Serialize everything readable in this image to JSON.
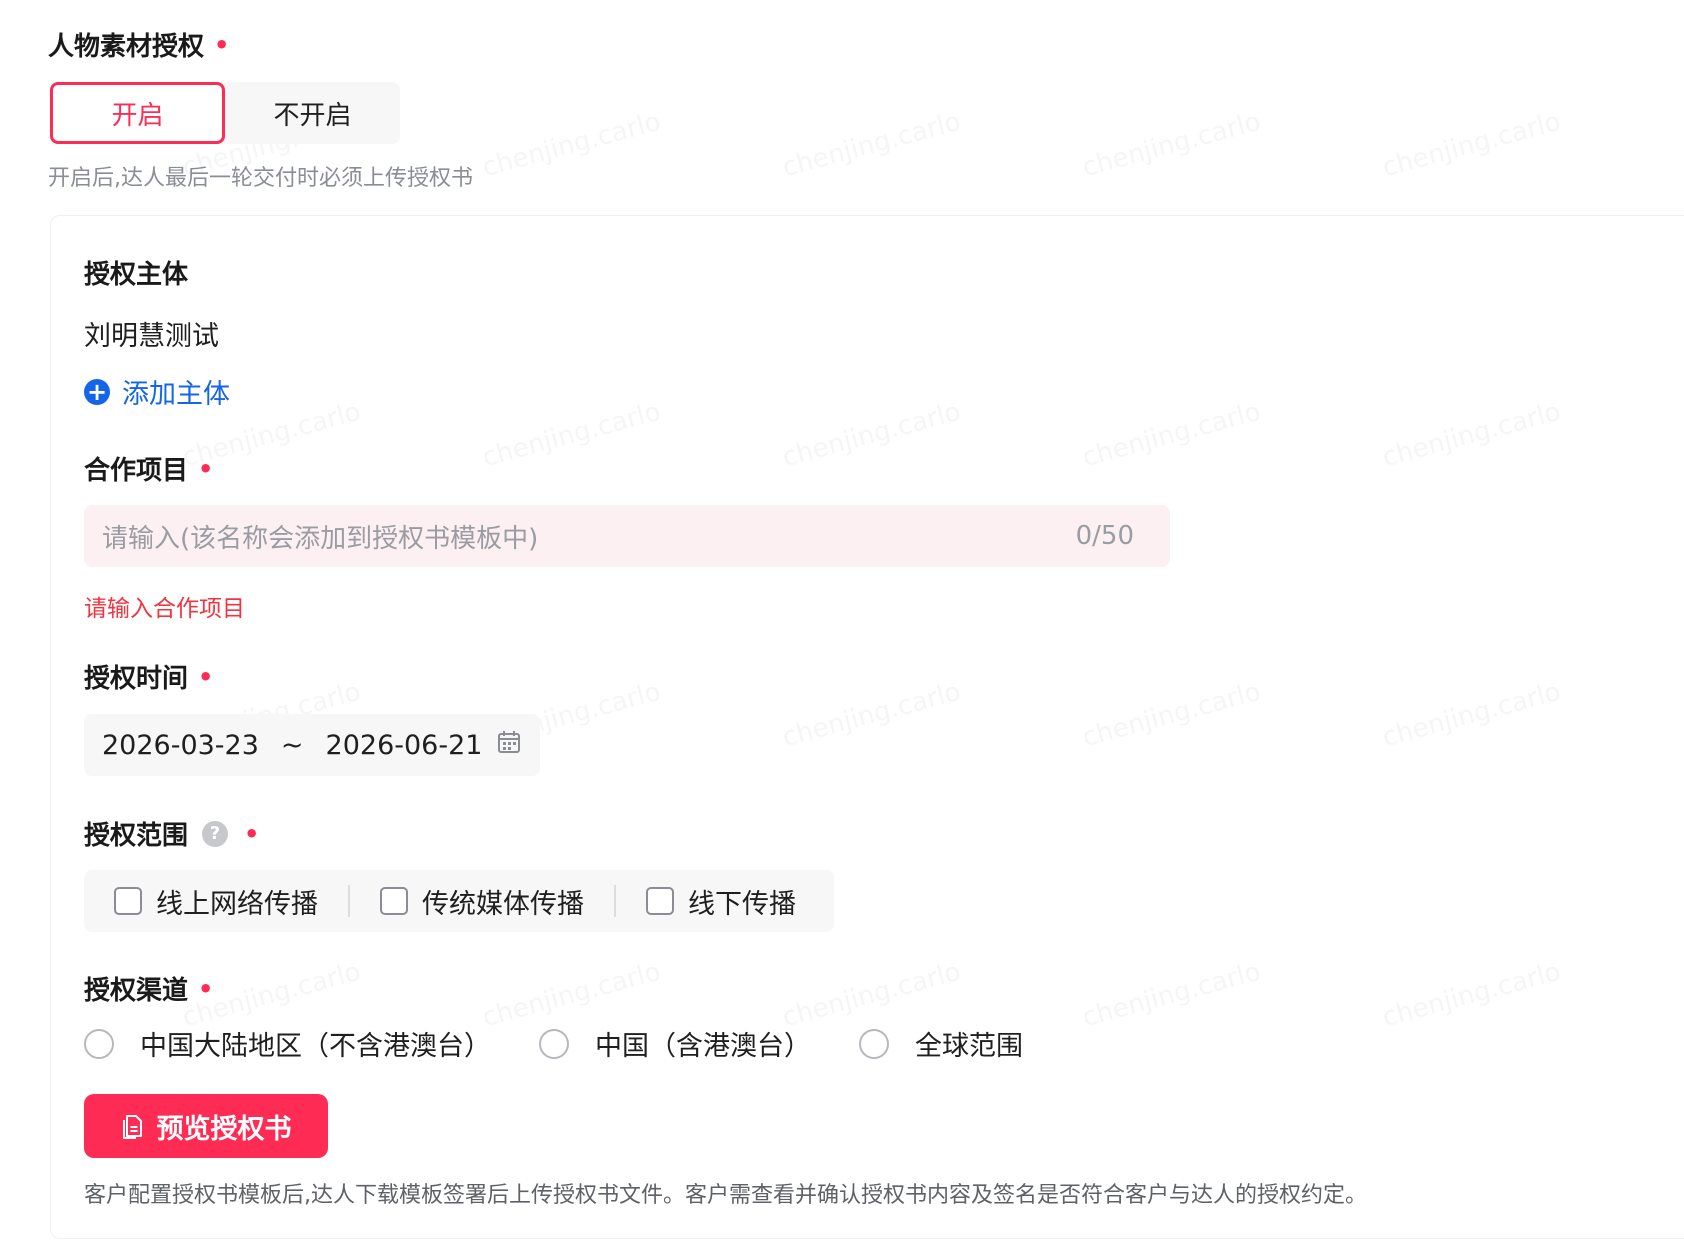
{
  "watermark": "chenjing.carlo",
  "portrait_auth": {
    "title": "人物素材授权",
    "required_mark": "•",
    "toggle": {
      "on_label": "开启",
      "off_label": "不开启",
      "selected": "开启"
    },
    "hint": "开启后,达人最后一轮交付时必须上传授权书"
  },
  "panel": {
    "subject": {
      "title": "授权主体",
      "value": "刘明慧测试",
      "add_icon": "plus-circle-icon",
      "add_label": "添加主体"
    },
    "project": {
      "title": "合作项目",
      "required_mark": "•",
      "placeholder": "请输入(该名称会添加到授权书模板中)",
      "counter": "0/50",
      "error": "请输入合作项目"
    },
    "time": {
      "title": "授权时间",
      "required_mark": "•",
      "start": "2026-03-23",
      "separator": "~",
      "end": "2026-06-21",
      "icon": "calendar-icon"
    },
    "scope": {
      "title": "授权范围",
      "help_icon": "question-circle-icon",
      "help_glyph": "?",
      "required_mark": "•",
      "options": [
        "线上网络传播",
        "传统媒体传播",
        "线下传播"
      ]
    },
    "channel": {
      "title": "授权渠道",
      "required_mark": "•",
      "options": [
        "中国大陆地区（不含港澳台）",
        "中国（含港澳台）",
        "全球范围"
      ]
    },
    "preview_button": {
      "icon": "document-icon",
      "label": "预览授权书"
    },
    "note": "客户配置授权书模板后,达人下载模板签署后上传授权书文件。客户需查看并确认授权书内容及签名是否符合客户与达人的授权约定。"
  },
  "colors": {
    "accent": "#fe2c55",
    "link": "#1565e8",
    "error": "#f0353f"
  }
}
